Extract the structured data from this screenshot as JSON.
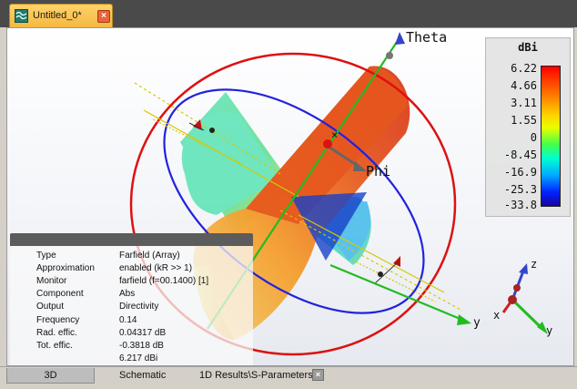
{
  "document_tab": {
    "label": "Untitled_0*",
    "close_icon": "close-icon",
    "app_icon": "farfield-document-icon"
  },
  "axes": {
    "theta_label": "Theta",
    "phi_label": "Phi",
    "y_label": "y"
  },
  "mini_axes": {
    "z_label": "z",
    "x_label": "x",
    "y_label": "y"
  },
  "colorbar": {
    "unit": "dBi",
    "ticks": [
      "6.22",
      "4.66",
      "3.11",
      "1.55",
      "0",
      "-8.45",
      "-16.9",
      "-25.3",
      "-33.8"
    ]
  },
  "info": {
    "rows": [
      {
        "key": "Type",
        "value": "Farfield (Array)"
      },
      {
        "key": "Approximation",
        "value": "enabled (kR >> 1)"
      },
      {
        "key": "Monitor",
        "value": "farfield (f=00.1400) [1]"
      },
      {
        "key": "Component",
        "value": "Abs"
      },
      {
        "key": "Output",
        "value": "Directivity"
      },
      {
        "key": "Frequency",
        "value": "0.14"
      },
      {
        "key": "Rad. effic.",
        "value": "0.04317 dB"
      },
      {
        "key": "Tot. effic.",
        "value": "-0.3818 dB"
      },
      {
        "key": "",
        "value": "6.217 dBi"
      }
    ]
  },
  "bottom_tabs": [
    {
      "label": "3D"
    },
    {
      "label": "Schematic"
    },
    {
      "label": "1D Results\\S-Parameters"
    }
  ],
  "colors": {
    "theta_ring": "#dd1111",
    "phi_ring": "#2222dd",
    "axis_green": "#22bb22",
    "axis_blue": "#3344cc"
  }
}
